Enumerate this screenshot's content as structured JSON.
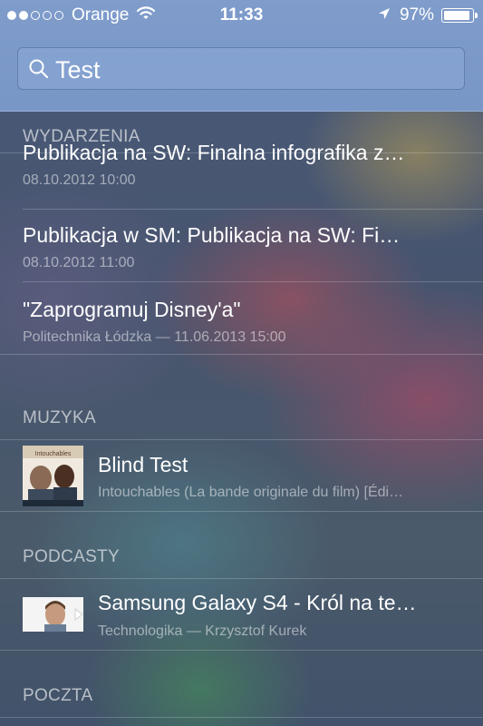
{
  "status_bar": {
    "carrier": "Orange",
    "signal_dots_filled": 2,
    "signal_dots_total": 5,
    "time": "11:33",
    "battery_percent_label": "97%",
    "battery_level": 0.97
  },
  "search": {
    "query": "Test"
  },
  "sections": {
    "events": {
      "header": "WYDARZENIA",
      "items": [
        {
          "title": "Publikacja na SW: Finalna infografika z…",
          "subtitle": "08.10.2012 10:00"
        },
        {
          "title": "Publikacja w SM: Publikacja na SW: Fi…",
          "subtitle": "08.10.2012 11:00"
        },
        {
          "title": "\"Zaprogramuj Disney'a\"",
          "subtitle": "Politechnika Łódzka — 11.06.2013 15:00"
        }
      ]
    },
    "music": {
      "header": "MUZYKA",
      "items": [
        {
          "title": "Blind Test",
          "subtitle": "Intouchables (La bande originale du film) [Édi…",
          "art_text": "Intouchables"
        }
      ]
    },
    "podcasts": {
      "header": "PODCASTY",
      "items": [
        {
          "title": "Samsung Galaxy S4 - Król na te…",
          "subtitle": "Technologika  —  Krzysztof Kurek"
        }
      ]
    },
    "mail": {
      "header": "POCZTA"
    }
  },
  "colors": {
    "status_bar_bg": "#7f9ccb",
    "search_field_bg": "#8caad7",
    "list_bg": "#46546e",
    "section_header_text": "#c5cbd6",
    "subtitle_text": "#b4bccb"
  }
}
